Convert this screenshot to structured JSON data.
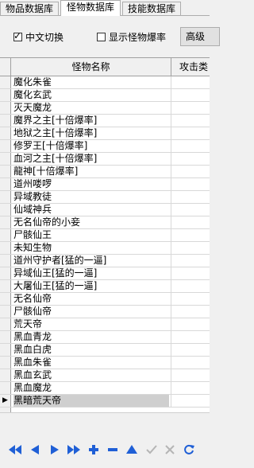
{
  "tabs": [
    {
      "label": "物品数据库",
      "active": false
    },
    {
      "label": "怪物数据库",
      "active": true
    },
    {
      "label": "技能数据库",
      "active": false
    }
  ],
  "toolbar": {
    "chinese_switch": {
      "label": "中文切换",
      "checked": true
    },
    "show_drop_rate": {
      "label": "显示怪物爆率",
      "checked": false
    },
    "advanced_button": "高级"
  },
  "grid": {
    "columns": [
      "怪物名称",
      "攻击类"
    ],
    "rows": [
      "魔化朱雀",
      "魔化玄武",
      "灭天魔龙",
      "魔界之主[十倍爆率]",
      "地狱之主[十倍爆率]",
      "修罗王[十倍爆率]",
      "血河之主[十倍爆率]",
      "龍神[十倍爆率]",
      "道州喽啰",
      "异域教徒",
      "仙域神兵",
      "无名仙帝的小妾",
      "尸骸仙王",
      "未知生物",
      "道州守护者[猛的一逼]",
      "异域仙王[猛的一逼]",
      "大屠仙王[猛的一逼]",
      "无名仙帝",
      "尸骸仙帝",
      "荒天帝",
      "黑血青龙",
      "黑血白虎",
      "黑血朱雀",
      "黑血玄武",
      "黑血魔龙",
      "黑暗荒天帝"
    ],
    "current_row_index": 25,
    "current_marker": "▶"
  },
  "navigator": {
    "buttons": [
      "first-icon",
      "prior-icon",
      "next-icon",
      "last-icon",
      "insert-icon",
      "delete-icon",
      "edit-icon",
      "post-icon",
      "cancel-icon",
      "refresh-icon"
    ],
    "colors": {
      "active": "#1f5fd6",
      "disabled": "#b5b5b5"
    }
  }
}
